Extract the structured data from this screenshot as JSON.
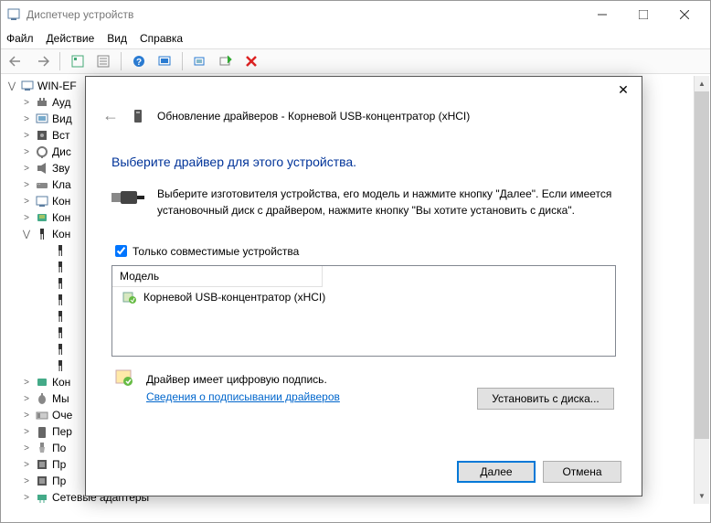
{
  "window": {
    "title": "Диспетчер устройств"
  },
  "menu": {
    "file": "Файл",
    "action": "Действие",
    "view": "Вид",
    "help": "Справка"
  },
  "tree": {
    "root": "WIN-EF",
    "items": [
      "Ауд",
      "Вид",
      "Вст",
      "Дис",
      "Зву",
      "Кла",
      "Кон",
      "Кон",
      "Кон"
    ],
    "subcount": 8,
    "after": [
      "Кон",
      "Мы",
      "Оче",
      "Пер",
      "По",
      "Пр",
      "Пр"
    ],
    "last": "Сетевые адаптеры"
  },
  "dialog": {
    "header": "Обновление драйверов - Корневой USB-концентратор (xHCI)",
    "heading": "Выберите драйвер для этого устройства.",
    "instruction": "Выберите изготовителя устройства, его модель и нажмите кнопку \"Далее\". Если имеется установочный диск с  драйвером, нажмите кнопку \"Вы хотите установить с диска\".",
    "compat_checkbox": "Только совместимые устройства",
    "list_header": "Модель",
    "list_item": "Корневой USB-концентратор (xHCI)",
    "signed_text": "Драйвер имеет цифровую подпись.",
    "signed_link": "Сведения о подписывании драйверов",
    "install_disk": "Установить с диска...",
    "next": "Далее",
    "cancel": "Отмена"
  }
}
